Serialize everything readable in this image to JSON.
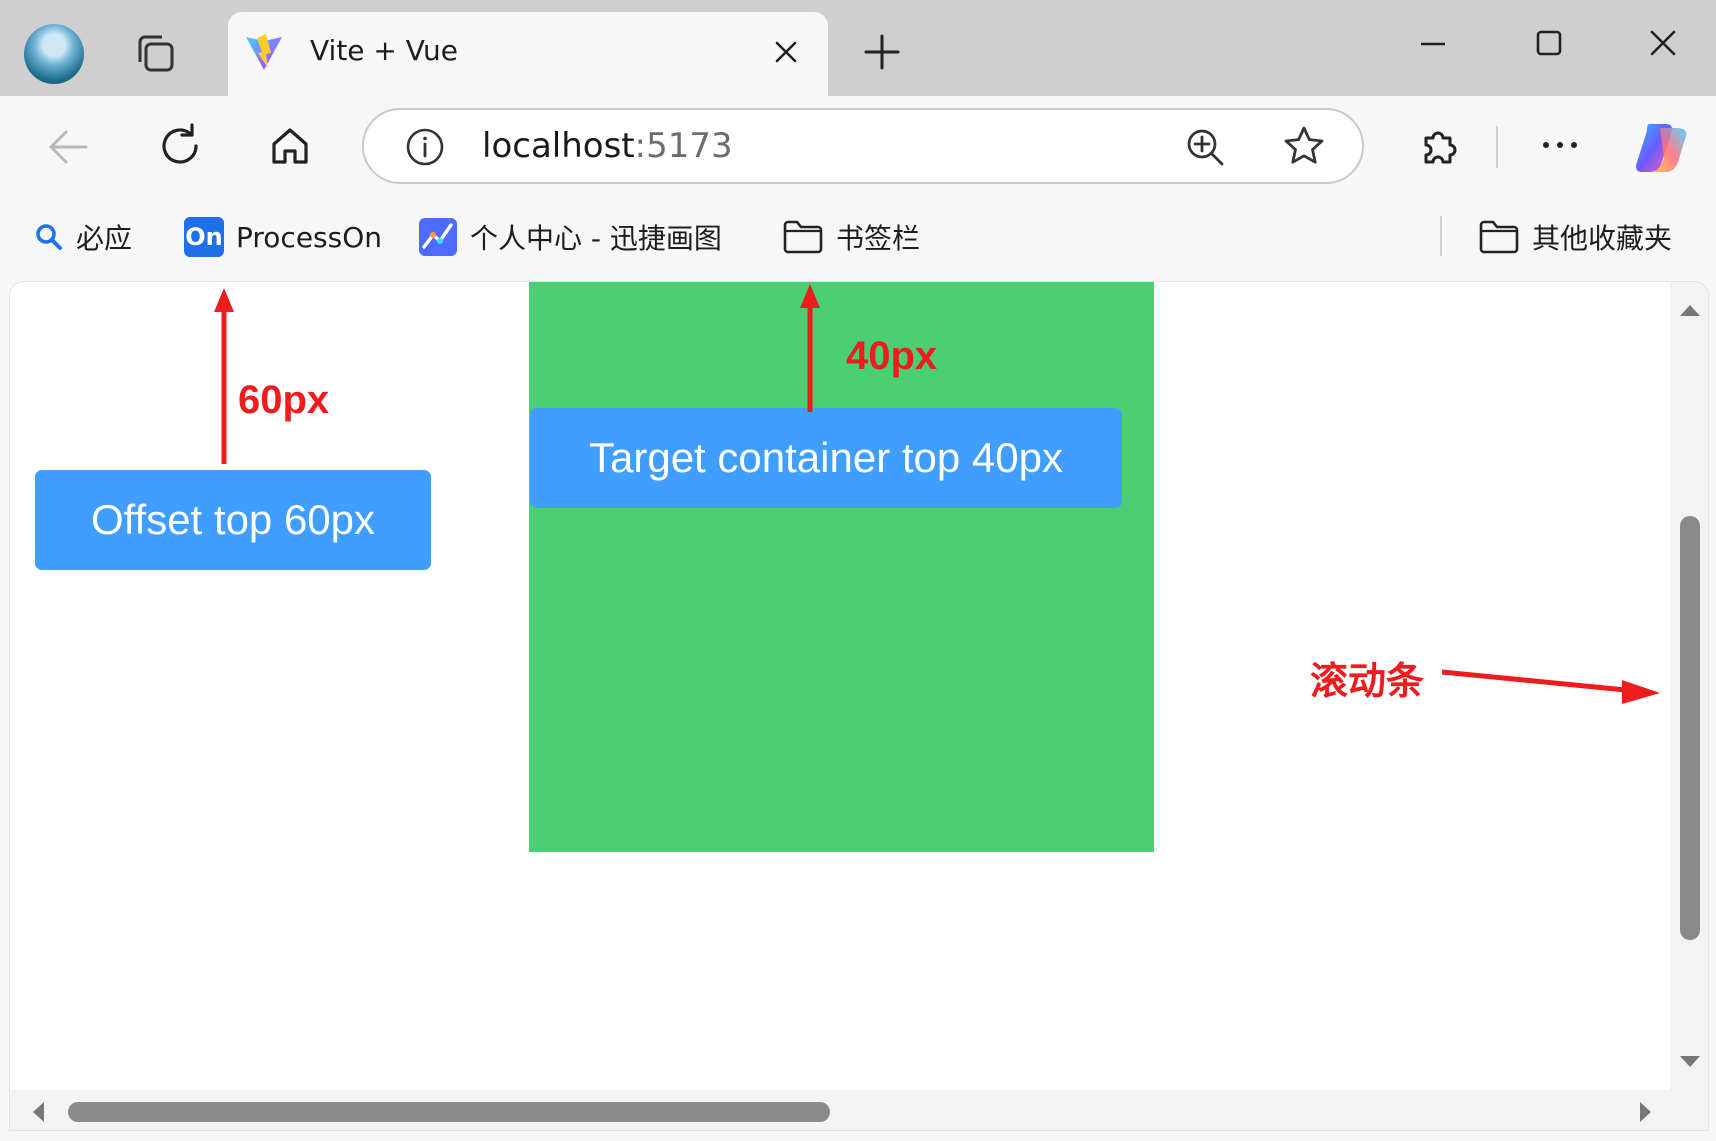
{
  "browser": {
    "tab": {
      "title": "Vite + Vue",
      "favicon": "vite-icon"
    },
    "url": {
      "host": "localhost",
      "port": ":5173"
    },
    "bookmarks": [
      {
        "label": "必应",
        "icon": "bing-search-icon"
      },
      {
        "label": "ProcessOn",
        "icon": "processon-icon",
        "logo_text": "On"
      },
      {
        "label": "个人中心 - 迅捷画图",
        "icon": "xunjie-icon"
      },
      {
        "label": "书签栏",
        "icon": "folder-icon"
      }
    ],
    "other_bookmarks": {
      "label": "其他收藏夹",
      "icon": "folder-icon"
    }
  },
  "page": {
    "offset_button": "Offset top 60px",
    "target_button": "Target container top 40px",
    "box_color": "#4bcf73",
    "button_color": "#409eff"
  },
  "annotations": {
    "offset_label": "60px",
    "target_label": "40px",
    "scrollbar_label": "滚动条",
    "color": "#ee1c1c"
  }
}
